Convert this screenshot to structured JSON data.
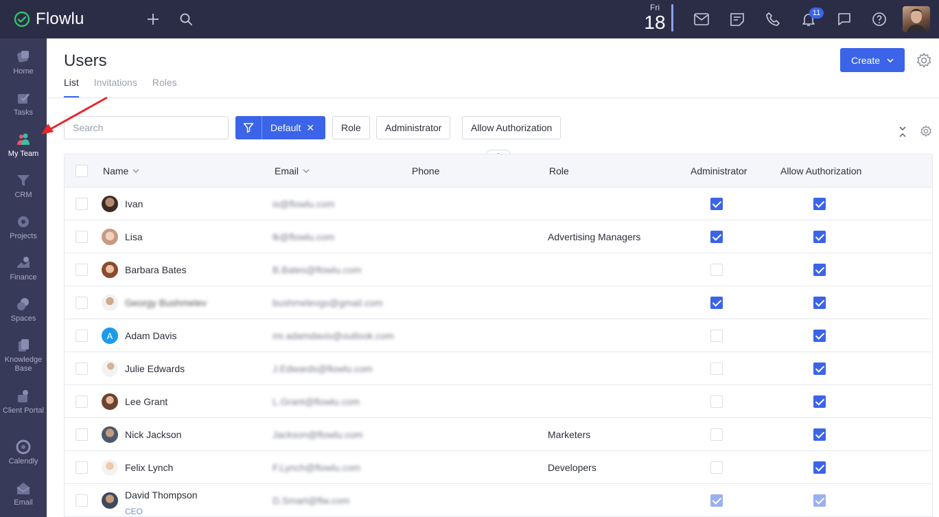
{
  "app": {
    "name": "Flowlu"
  },
  "topbar": {
    "day_of_week": "Fri",
    "day": "18",
    "notification_count": "11"
  },
  "sidebar": {
    "items": [
      {
        "label": "Home",
        "icon": "home-icon"
      },
      {
        "label": "Tasks",
        "icon": "tasks-icon"
      },
      {
        "label": "My Team",
        "icon": "team-icon",
        "active": true
      },
      {
        "label": "CRM",
        "icon": "crm-icon"
      },
      {
        "label": "Projects",
        "icon": "projects-icon"
      },
      {
        "label": "Finance",
        "icon": "finance-icon"
      },
      {
        "label": "Spaces",
        "icon": "spaces-icon"
      },
      {
        "label": "Knowledge Base",
        "icon": "knowledge-base-icon"
      },
      {
        "label": "Client Portal",
        "icon": "client-portal-icon"
      },
      {
        "label": "Calendly",
        "icon": "calendly-icon"
      },
      {
        "label": "Email",
        "icon": "email-icon"
      }
    ]
  },
  "page": {
    "title": "Users",
    "tabs": [
      "List",
      "Invitations",
      "Roles"
    ],
    "create_label": "Create"
  },
  "filters": {
    "search_placeholder": "Search",
    "default_label": "Default",
    "chips": [
      "Role",
      "Administrator",
      "Allow Authorization"
    ]
  },
  "table": {
    "columns": [
      "Name",
      "Email",
      "Phone",
      "Role",
      "Administrator",
      "Allow Authorization"
    ],
    "rows": [
      {
        "name": "Ivan",
        "subtitle": "",
        "email": "is@flowlu.com",
        "role": "",
        "admin": true,
        "auth": true
      },
      {
        "name": "Lisa",
        "subtitle": "",
        "email": "lk@flowlu.com",
        "role": "Advertising Managers",
        "admin": true,
        "auth": true
      },
      {
        "name": "Barbara Bates",
        "subtitle": "",
        "email": "B.Bates@flowlu.com",
        "role": "",
        "admin": false,
        "auth": true
      },
      {
        "name": "Georgy Bushmelev",
        "subtitle": "",
        "email": "bushmelevgs@gmail.com",
        "role": "",
        "admin": true,
        "auth": true
      },
      {
        "name": "Adam Davis",
        "subtitle": "",
        "email": "mr.adamdavis@outlook.com",
        "role": "",
        "admin": false,
        "auth": true,
        "initial": "A"
      },
      {
        "name": "Julie Edwards",
        "subtitle": "",
        "email": "J.Edwards@flowlu.com",
        "role": "",
        "admin": false,
        "auth": true
      },
      {
        "name": "Lee Grant",
        "subtitle": "",
        "email": "L.Grant@flowlu.com",
        "role": "",
        "admin": false,
        "auth": true
      },
      {
        "name": "Nick Jackson",
        "subtitle": "",
        "email": "Jackson@flowlu.com",
        "role": "Marketers",
        "admin": false,
        "auth": true
      },
      {
        "name": "Felix Lynch",
        "subtitle": "",
        "email": "F.Lynch@flowlu.com",
        "role": "Developers",
        "admin": false,
        "auth": true
      },
      {
        "name": "David Thompson",
        "subtitle": "CEO",
        "email": "D.Smart@flw.com",
        "role": "",
        "admin": true,
        "auth": true
      }
    ]
  },
  "colors": {
    "accent": "#3b64e8",
    "topbar": "#2b2d47",
    "sidebar": "#383a59",
    "annotation_arrow": "#e8262b"
  }
}
